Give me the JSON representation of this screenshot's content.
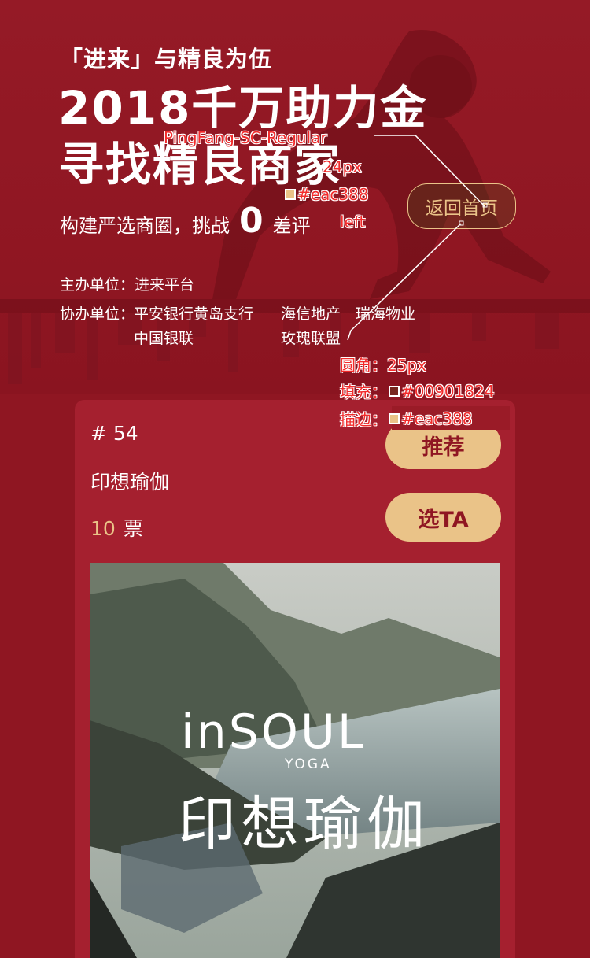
{
  "hero": {
    "tagline": "「进来」与精良为伍",
    "headline_1": "2018千万助力金",
    "headline_2": "寻找精良商家",
    "challenge_prefix": "构建严选商圈，挑战",
    "challenge_number": "0",
    "challenge_suffix": "差评",
    "back_button": "返回首页"
  },
  "organizers": {
    "host_label": "主办单位：",
    "host": "进来平台",
    "co_label": "协办单位：",
    "co": [
      "平安银行黄岛支行",
      "海信地产",
      "瑞海物业",
      "中国银联",
      "玫瑰联盟"
    ]
  },
  "annotations": {
    "font": "PingFang-SC-Regular",
    "size": "24px",
    "color": "#eac388",
    "align": "left",
    "radius_line": "圆角：25px",
    "fill_label": "填充：",
    "fill_value": "#00901824",
    "stroke_label": "描边：",
    "stroke_value": "#eac388"
  },
  "card": {
    "number": "# 54",
    "name": "印想瑜伽",
    "votes_count": "10",
    "votes_unit": "票",
    "recommend_button": "推荐",
    "vote_button": "选TA",
    "logo_brand": "inSOUL",
    "logo_sub": "YOGA",
    "logo_cn": "印想瑜伽"
  },
  "colors": {
    "background": "#8f1622",
    "card": "#a5202f",
    "accent": "#eac388",
    "annotation": "#f22b2b"
  }
}
